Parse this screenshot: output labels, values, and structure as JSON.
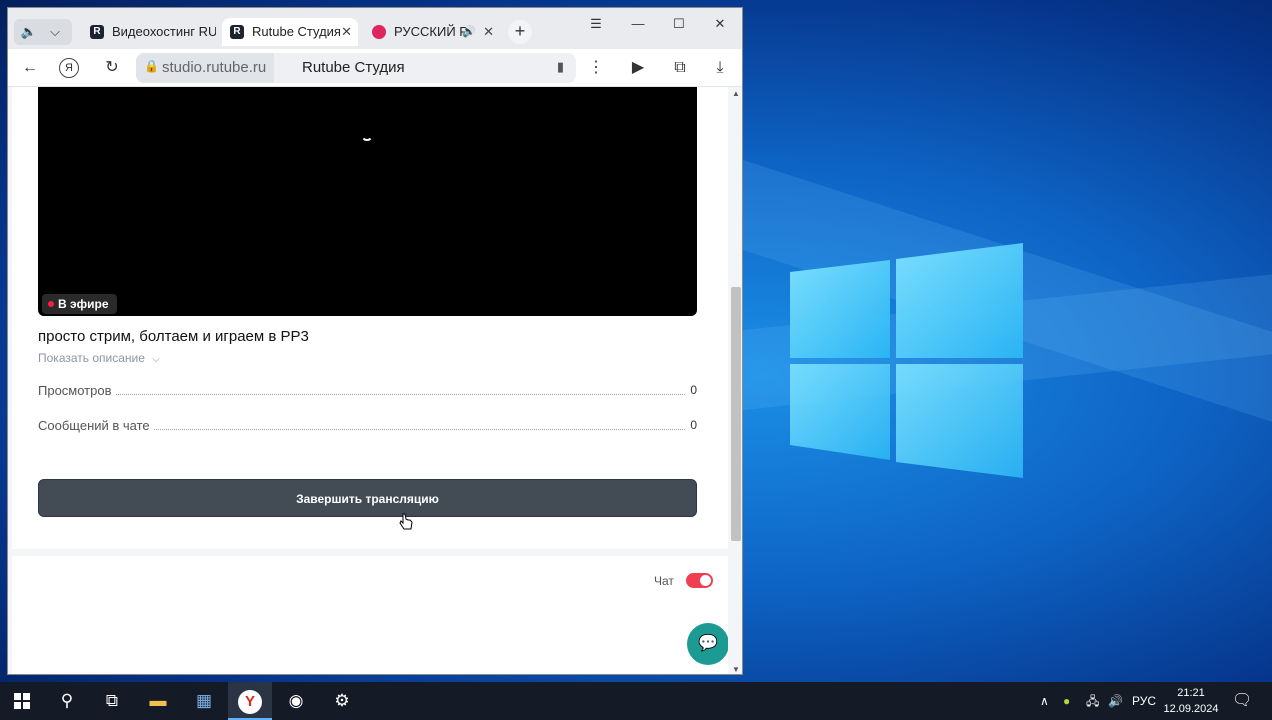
{
  "browser": {
    "tabs": [
      {
        "label": "Видеохостинг RU",
        "favicon": "R",
        "active": false
      },
      {
        "label": "Rutube Студия",
        "favicon": "R",
        "active": true
      },
      {
        "label": "РУССКИЙ Р",
        "favicon": "rec",
        "active": false
      }
    ],
    "address": {
      "host": "studio.rutube.ru",
      "page_title": "Rutube Студия"
    }
  },
  "stream": {
    "live_badge": "В эфире",
    "title": "просто стрим, болтаем и играем в PP3",
    "show_description": "Показать описание",
    "stats": [
      {
        "label": "Просмотров",
        "value": "0"
      },
      {
        "label": "Сообщений в чате",
        "value": "0"
      }
    ],
    "end_button": "Завершить трансляцию"
  },
  "chat": {
    "label": "Чат",
    "enabled": true
  },
  "taskbar": {
    "language": "РУС",
    "time": "21:21",
    "date": "12.09.2024"
  },
  "colors": {
    "accent_red": "#ef3f51",
    "button_dark": "#434b55",
    "chat_fab": "#1e9a94"
  }
}
